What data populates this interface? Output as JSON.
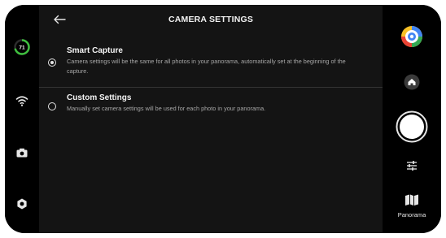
{
  "header": {
    "title": "CAMERA SETTINGS"
  },
  "left_bar": {
    "battery_level": "71",
    "battery_color": "#3fbf3f"
  },
  "options": [
    {
      "title": "Smart Capture",
      "description": "Camera settings will be the same for all photos in your panorama, automatically set at the beginning of the capture.",
      "selected": true
    },
    {
      "title": "Custom Settings",
      "description": "Manually set camera settings will be used for each photo in your panorama.",
      "selected": false
    }
  ],
  "right_bar": {
    "panorama_label": "Panorama"
  },
  "icons": [
    "back-arrow-icon",
    "battery-ring-icon",
    "wifi-icon",
    "camera-icon",
    "settings-gear-icon",
    "google-maps-icon",
    "home-icon",
    "shutter-button",
    "sliders-icon",
    "map-icon"
  ],
  "colors": {
    "background": "#141414",
    "bars": "#000000",
    "text": "#f4f4f4",
    "muted": "#a7a7a7"
  }
}
